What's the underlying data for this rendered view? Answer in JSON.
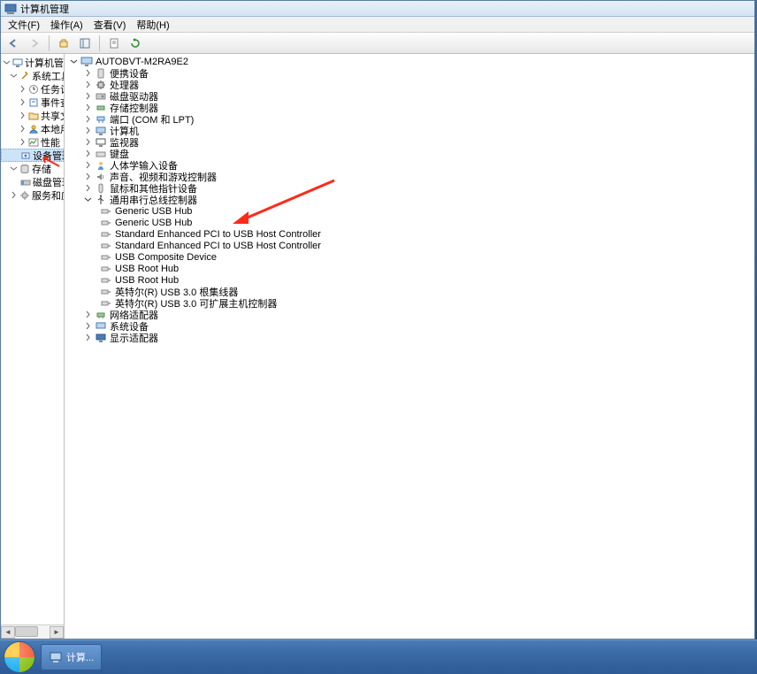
{
  "window": {
    "title": "计算机管理"
  },
  "menu": {
    "file": "文件(F)",
    "action": "操作(A)",
    "view": "查看(V)",
    "help": "帮助(H)"
  },
  "left_tree": {
    "root": "计算机管理(本",
    "system_tools": "系统工具",
    "task_scheduler": "任务计划程",
    "event_viewer": "事件查看器",
    "shared_folders": "共享文件夹",
    "local_users": "本地用户和",
    "performance": "性能",
    "device_manager": "设备管理器",
    "storage": "存储",
    "disk_mgmt": "磁盘管理",
    "services_apps": "服务和应用程"
  },
  "device_tree": {
    "root": "AUTOBVT-M2RA9E2",
    "portable": "便携设备",
    "processors": "处理器",
    "disk_drives": "磁盘驱动器",
    "storage_ctrl": "存储控制器",
    "ports": "端口 (COM 和 LPT)",
    "computer": "计算机",
    "monitors": "监视器",
    "keyboards": "键盘",
    "hid": "人体学输入设备",
    "sound": "声音、视频和游戏控制器",
    "mouse": "鼠标和其他指针设备",
    "usb_controllers": "通用串行总线控制器",
    "usb_children": [
      "Generic USB Hub",
      "Generic USB Hub",
      "Standard Enhanced PCI to USB Host Controller",
      "Standard Enhanced PCI to USB Host Controller",
      "USB Composite Device",
      "USB Root Hub",
      "USB Root Hub",
      "英特尔(R) USB 3.0 根集线器",
      "英特尔(R) USB 3.0 可扩展主机控制器"
    ],
    "network": "网络适配器",
    "system_devices": "系统设备",
    "display": "显示适配器"
  },
  "taskbar": {
    "item1": "计算..."
  },
  "colors": {
    "accent": "#3a6aa5",
    "arrow": "#ff2a1a"
  }
}
